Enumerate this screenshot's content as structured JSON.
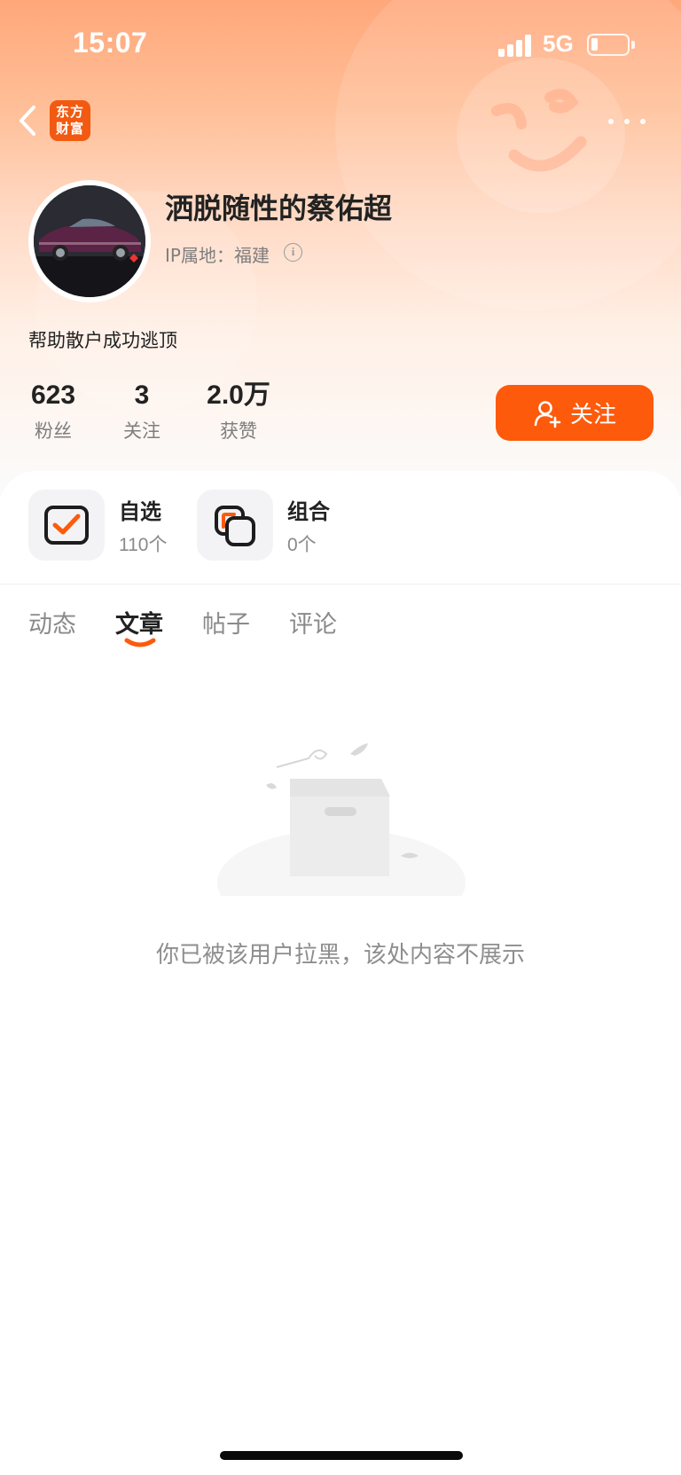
{
  "status_bar": {
    "time": "15:07",
    "network": "5G"
  },
  "app": {
    "logo_text_line1": "东方",
    "logo_text_line2": "财富"
  },
  "profile": {
    "name": "洒脱随性的蔡佑超",
    "ip_location": "IP属地：福建",
    "bio": "帮助散户成功逃顶"
  },
  "stats": [
    {
      "value": "623",
      "label": "粉丝"
    },
    {
      "value": "3",
      "label": "关注"
    },
    {
      "value": "2.0万",
      "label": "获赞"
    }
  ],
  "follow_button": {
    "label": "关注"
  },
  "collections": [
    {
      "title": "自选",
      "count": "110个"
    },
    {
      "title": "组合",
      "count": "0个"
    }
  ],
  "tabs": [
    {
      "label": "动态",
      "active": false
    },
    {
      "label": "文章",
      "active": true
    },
    {
      "label": "帖子",
      "active": false
    },
    {
      "label": "评论",
      "active": false
    }
  ],
  "empty_state": {
    "message": "你已被该用户拉黑，该处内容不展示"
  },
  "colors": {
    "accent": "#fd5a0c",
    "logo": "#f25a12",
    "text": "#222222",
    "muted": "#8a8a8a"
  }
}
